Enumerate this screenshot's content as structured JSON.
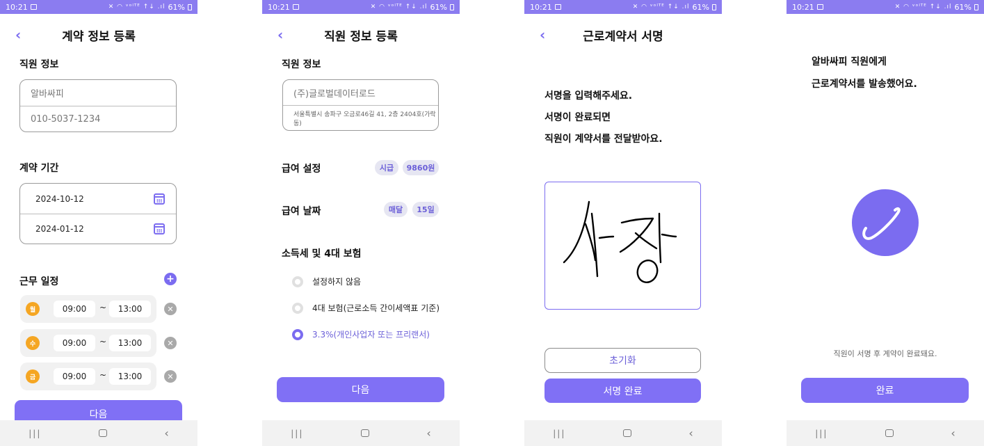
{
  "status": {
    "time": "10:21",
    "battery": "61%",
    "icons": "✕ ◠ ᵛᵒˡᵀᴱ ↑↓ .ıl"
  },
  "screen1": {
    "title": "계약 정보 등록",
    "employee_section": "직원 정보",
    "employee_name_placeholder": "알바싸피",
    "employee_phone_placeholder": "010-5037-1234",
    "period_section": "계약 기간",
    "start_date": "2024-10-12",
    "end_date": "2024-01-12",
    "schedule_section": "근무 일정",
    "schedule": [
      {
        "day": "월",
        "start": "09:00",
        "end": "13:00"
      },
      {
        "day": "수",
        "start": "09:00",
        "end": "13:00"
      },
      {
        "day": "금",
        "start": "09:00",
        "end": "13:00"
      }
    ],
    "tilde": "~",
    "next_label": "다음"
  },
  "screen2": {
    "title": "직원 정보 등록",
    "employee_section": "직원 정보",
    "company_name": "(주)글로벌데이터로드",
    "company_address": "서울특별시 송파구 오금로46길 41, 2층 2404호(가락동)",
    "wage_section": "급여 설정",
    "wage_type": "시급",
    "wage_amount": "9860원",
    "payday_section": "급여 날짜",
    "payday_cycle": "매달",
    "payday_day": "15일",
    "tax_section": "소득세 및 4대 보험",
    "tax_options": [
      "설정하지 않음",
      "4대 보험(근로소득 간이세액표 기준)",
      "3.3%(개인사업자 또는 프리랜서)"
    ],
    "tax_selected_index": 2,
    "next_label": "다음"
  },
  "screen3": {
    "title": "근로계약서 서명",
    "instruction_1": "서명을 입력해주세요.",
    "instruction_2": "서명이 완료되면",
    "instruction_3": "직원이 계약서를 전달받아요.",
    "reset_label": "초기화",
    "complete_label": "서명 완료"
  },
  "screen4": {
    "message_1": "알바싸피 직원에게",
    "message_2": "근로계약서를 발송했어요.",
    "note": "직원이 서명 후 계약이 완료돼요.",
    "done_label": "완료"
  },
  "colors": {
    "accent": "#8070f5",
    "status_bar": "#8b7cf0",
    "day_badge": "#f5a623"
  }
}
